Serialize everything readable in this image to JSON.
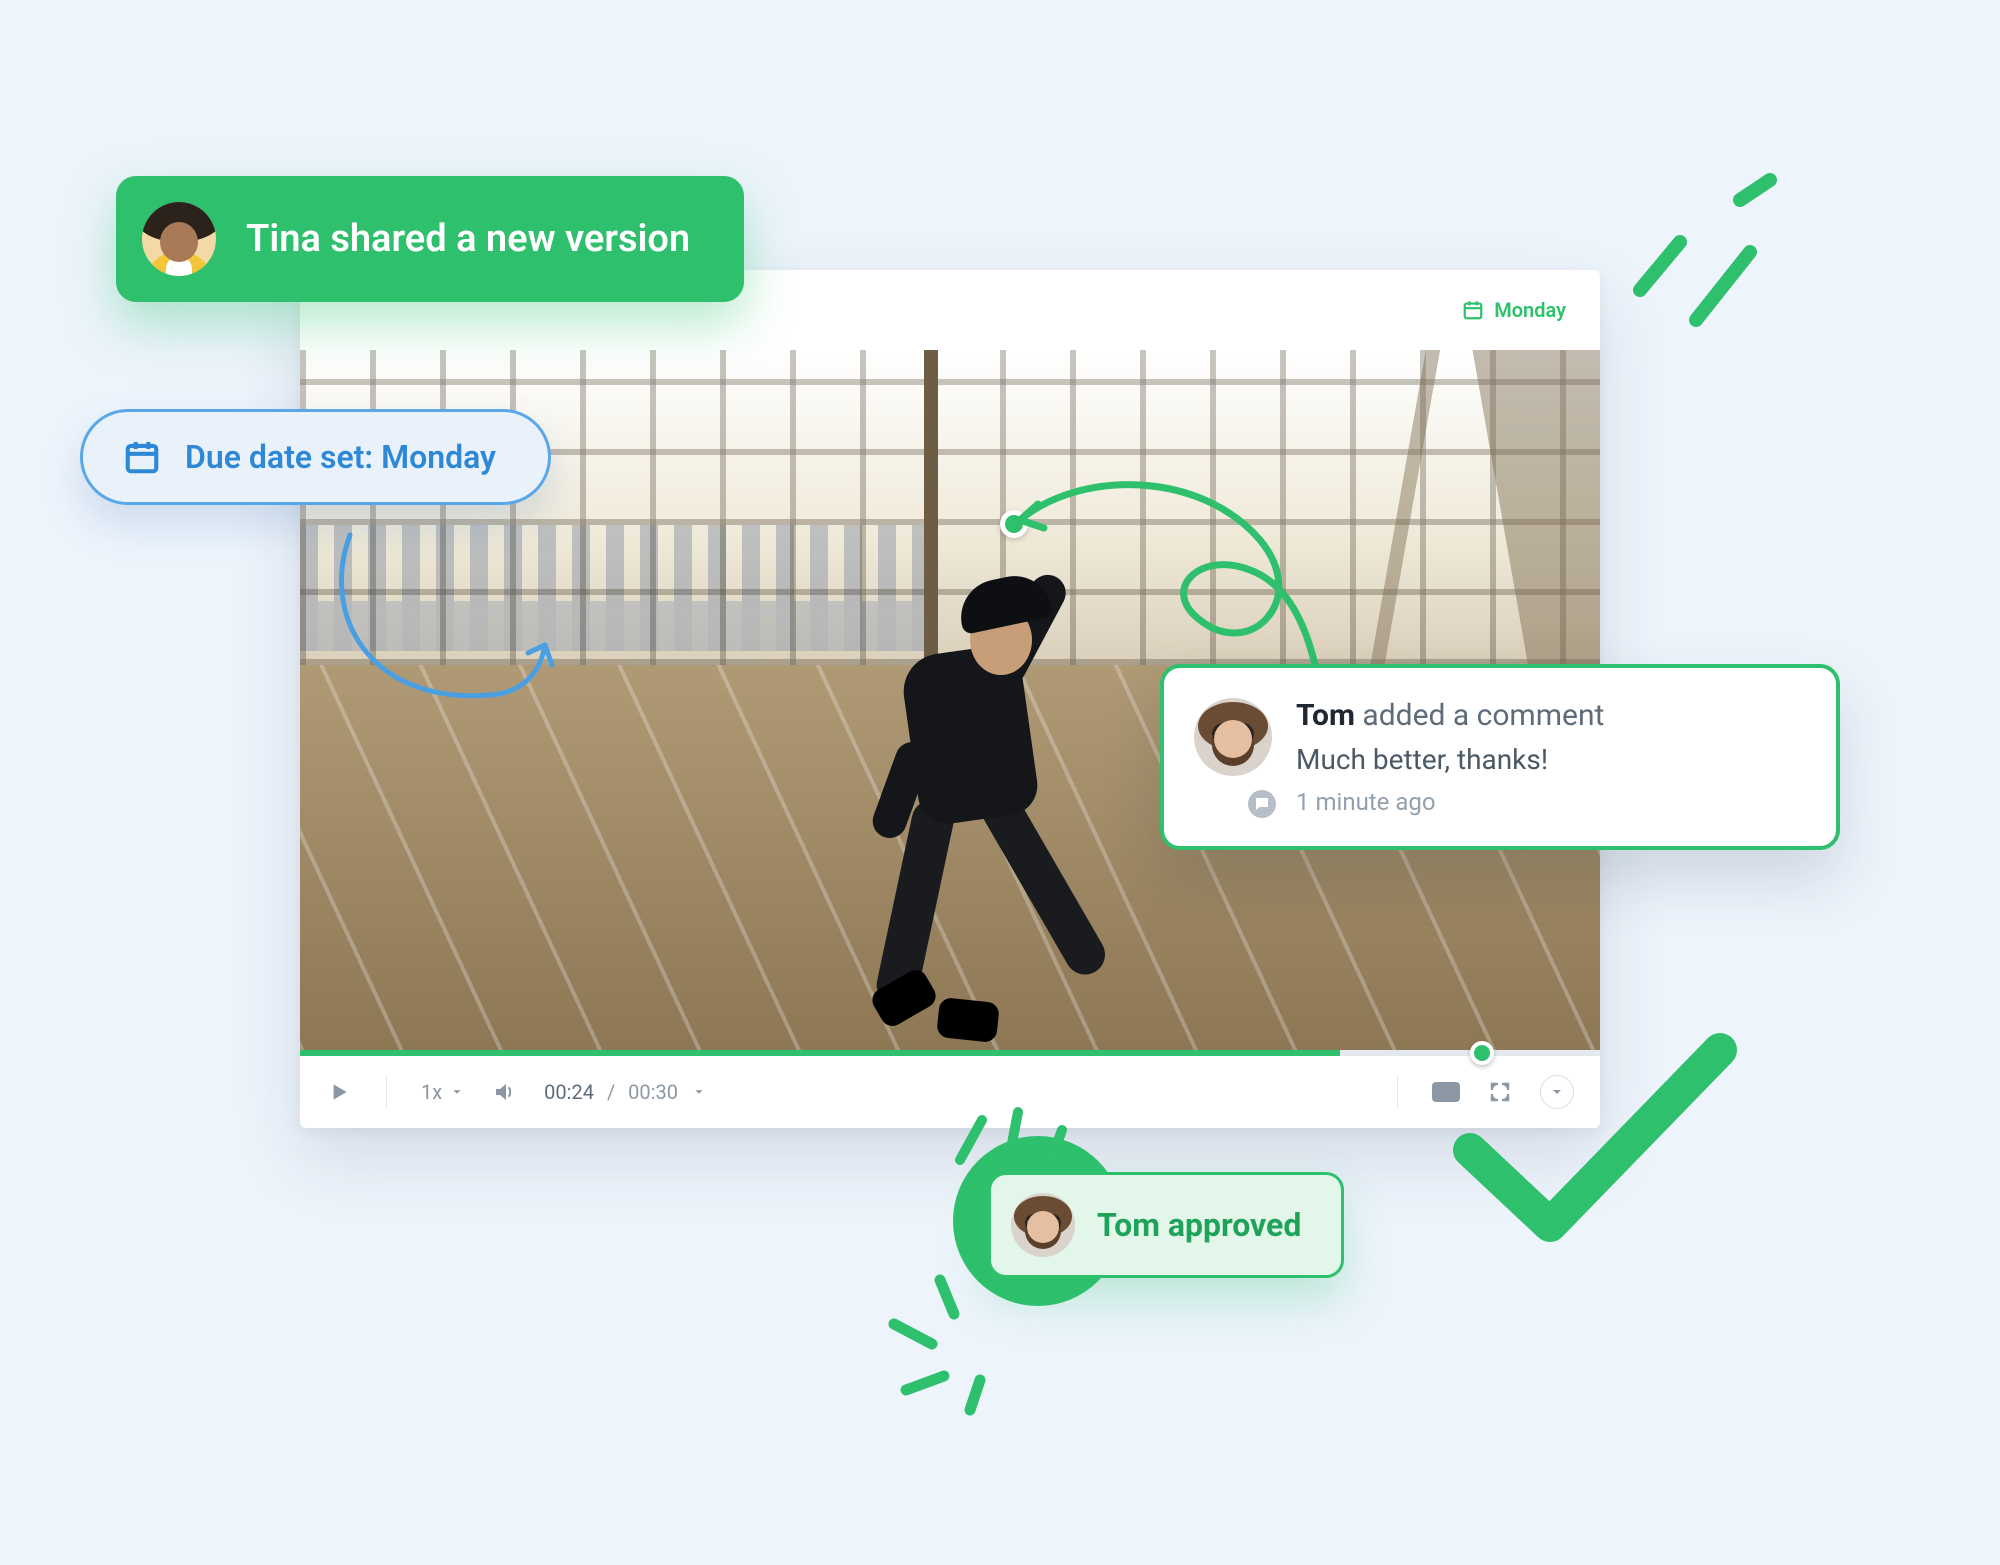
{
  "header": {
    "due_label": "Monday"
  },
  "controls": {
    "speed": "1x",
    "time_current": "00:24",
    "time_total": "00:30"
  },
  "timeline": {
    "progress_percent": 80,
    "marker_percent": 90
  },
  "toast_shared": {
    "text": "Tina shared a new version"
  },
  "due_pill": {
    "text": "Due date set: Monday"
  },
  "comment": {
    "author": "Tom",
    "action": " added a comment",
    "body": "Much better, thanks!",
    "time": "1 minute ago"
  },
  "approved": {
    "text": "Tom approved"
  }
}
